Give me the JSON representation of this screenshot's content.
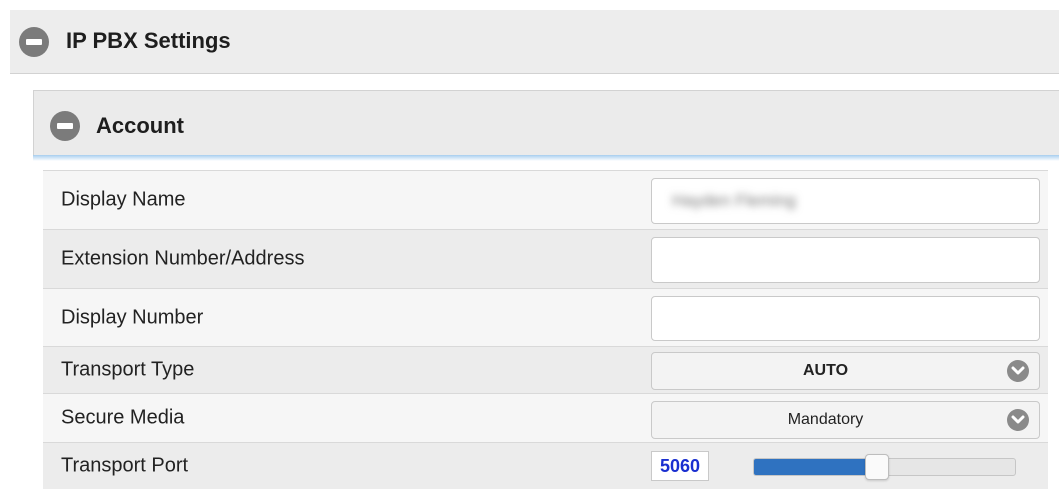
{
  "sections": {
    "outer": {
      "title": "IP PBX Settings",
      "icon": "collapse-icon"
    },
    "inner": {
      "title": "Account",
      "icon": "collapse-icon"
    }
  },
  "form": {
    "display_name": {
      "label": "Display Name",
      "value": "Hayden Fleming"
    },
    "extension": {
      "label": "Extension Number/Address",
      "value": ""
    },
    "display_number": {
      "label": "Display Number",
      "value": ""
    },
    "transport_type": {
      "label": "Transport Type",
      "selected": "AUTO",
      "icon": "chevron-down-icon"
    },
    "secure_media": {
      "label": "Secure Media",
      "selected": "Mandatory",
      "icon": "chevron-down-icon"
    },
    "transport_port": {
      "label": "Transport Port",
      "value": "5060",
      "slider_level": 0.47
    }
  },
  "colors": {
    "port_text": "#1a2fd0",
    "slider_fill": "#2f72c0"
  }
}
